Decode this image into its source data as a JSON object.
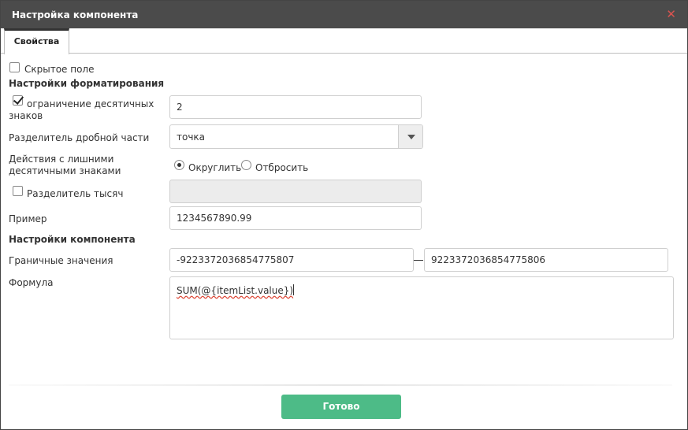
{
  "dialog": {
    "title": "Настройка компонента",
    "close_icon": "close-icon"
  },
  "tabs": [
    {
      "label": "Свойства",
      "active": true
    }
  ],
  "form": {
    "hidden_field": {
      "label": "Скрытое поле",
      "checked": false
    },
    "formatting_header": "Настройки форматирования",
    "decimal_limit": {
      "label_line1": "ограничение десятичных",
      "label_line2": "знаков",
      "checked": true,
      "value": "2"
    },
    "decimal_separator": {
      "label": "Разделитель дробной части",
      "value": "точка",
      "arrow_icon": "chevron-down-icon"
    },
    "extra_decimals": {
      "label_line1": "Действия с лишними",
      "label_line2": "десятичными знаками",
      "options": [
        {
          "label": "Округлить",
          "selected": true
        },
        {
          "label": "Отбросить",
          "selected": false
        }
      ]
    },
    "thousands_separator": {
      "label": "Разделитель тысяч",
      "checked": false,
      "value": ""
    },
    "example": {
      "label": "Пример",
      "value": "1234567890.99"
    },
    "component_header": "Настройки компонента",
    "bounds": {
      "label": "Граничные значения",
      "min": "-9223372036854775807",
      "max": "9223372036854775806"
    },
    "formula": {
      "label": "Формула",
      "value": "SUM(@{itemList.value})"
    }
  },
  "footer": {
    "done_label": "Готово"
  },
  "colors": {
    "titlebar": "#4b4b4b",
    "close": "#d9534f",
    "primary_button": "#4dbb87"
  }
}
